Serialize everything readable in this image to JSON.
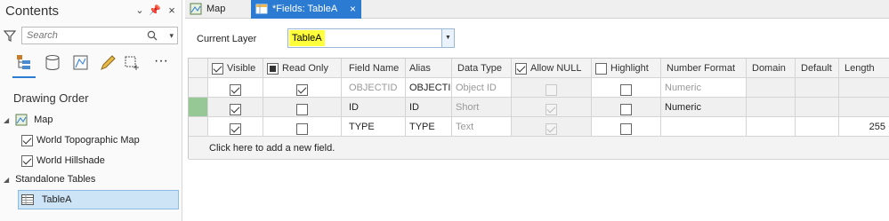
{
  "contents": {
    "title": "Contents",
    "search_placeholder": "Search",
    "drawing_order_label": "Drawing Order",
    "tree": {
      "map": "Map",
      "layers": [
        {
          "label": "World Topographic Map",
          "checked": true
        },
        {
          "label": "World Hillshade",
          "checked": true
        }
      ],
      "standalone_tables": "Standalone Tables",
      "table": "TableA"
    }
  },
  "tabs": [
    {
      "label": "Map",
      "icon": "map-icon",
      "active": false
    },
    {
      "label": "*Fields:  TableA",
      "icon": "fields-table-icon",
      "active": true
    }
  ],
  "current_layer": {
    "label": "Current Layer",
    "value": "TableA"
  },
  "grid": {
    "headers": {
      "visible": "Visible",
      "read_only": "Read Only",
      "field_name": "Field Name",
      "alias": "Alias",
      "data_type": "Data Type",
      "allow_null": "Allow NULL",
      "highlight": "Highlight",
      "number_format": "Number Format",
      "domain": "Domain",
      "default": "Default",
      "length": "Length"
    },
    "rows": [
      {
        "visible": true,
        "read_only": true,
        "field_name": "OBJECTID",
        "alias": "OBJECTID",
        "data_type": "Object ID",
        "allow_null": false,
        "highlight": false,
        "number_format": "Numeric",
        "domain": "",
        "default": "",
        "length": ""
      },
      {
        "visible": true,
        "read_only": false,
        "field_name": "ID",
        "alias": "ID",
        "data_type": "Short",
        "allow_null": true,
        "highlight": false,
        "number_format": "Numeric",
        "domain": "",
        "default": "",
        "length": ""
      },
      {
        "visible": true,
        "read_only": false,
        "field_name": "TYPE",
        "alias": "TYPE",
        "data_type": "Text",
        "allow_null": true,
        "highlight": false,
        "number_format": "",
        "domain": "",
        "default": "",
        "length": "255"
      }
    ],
    "add_field_text": "Click here to add a new field."
  },
  "colors": {
    "accent": "#2b7bd3",
    "highlight": "#ffff3c",
    "current_row": "#96c896"
  }
}
